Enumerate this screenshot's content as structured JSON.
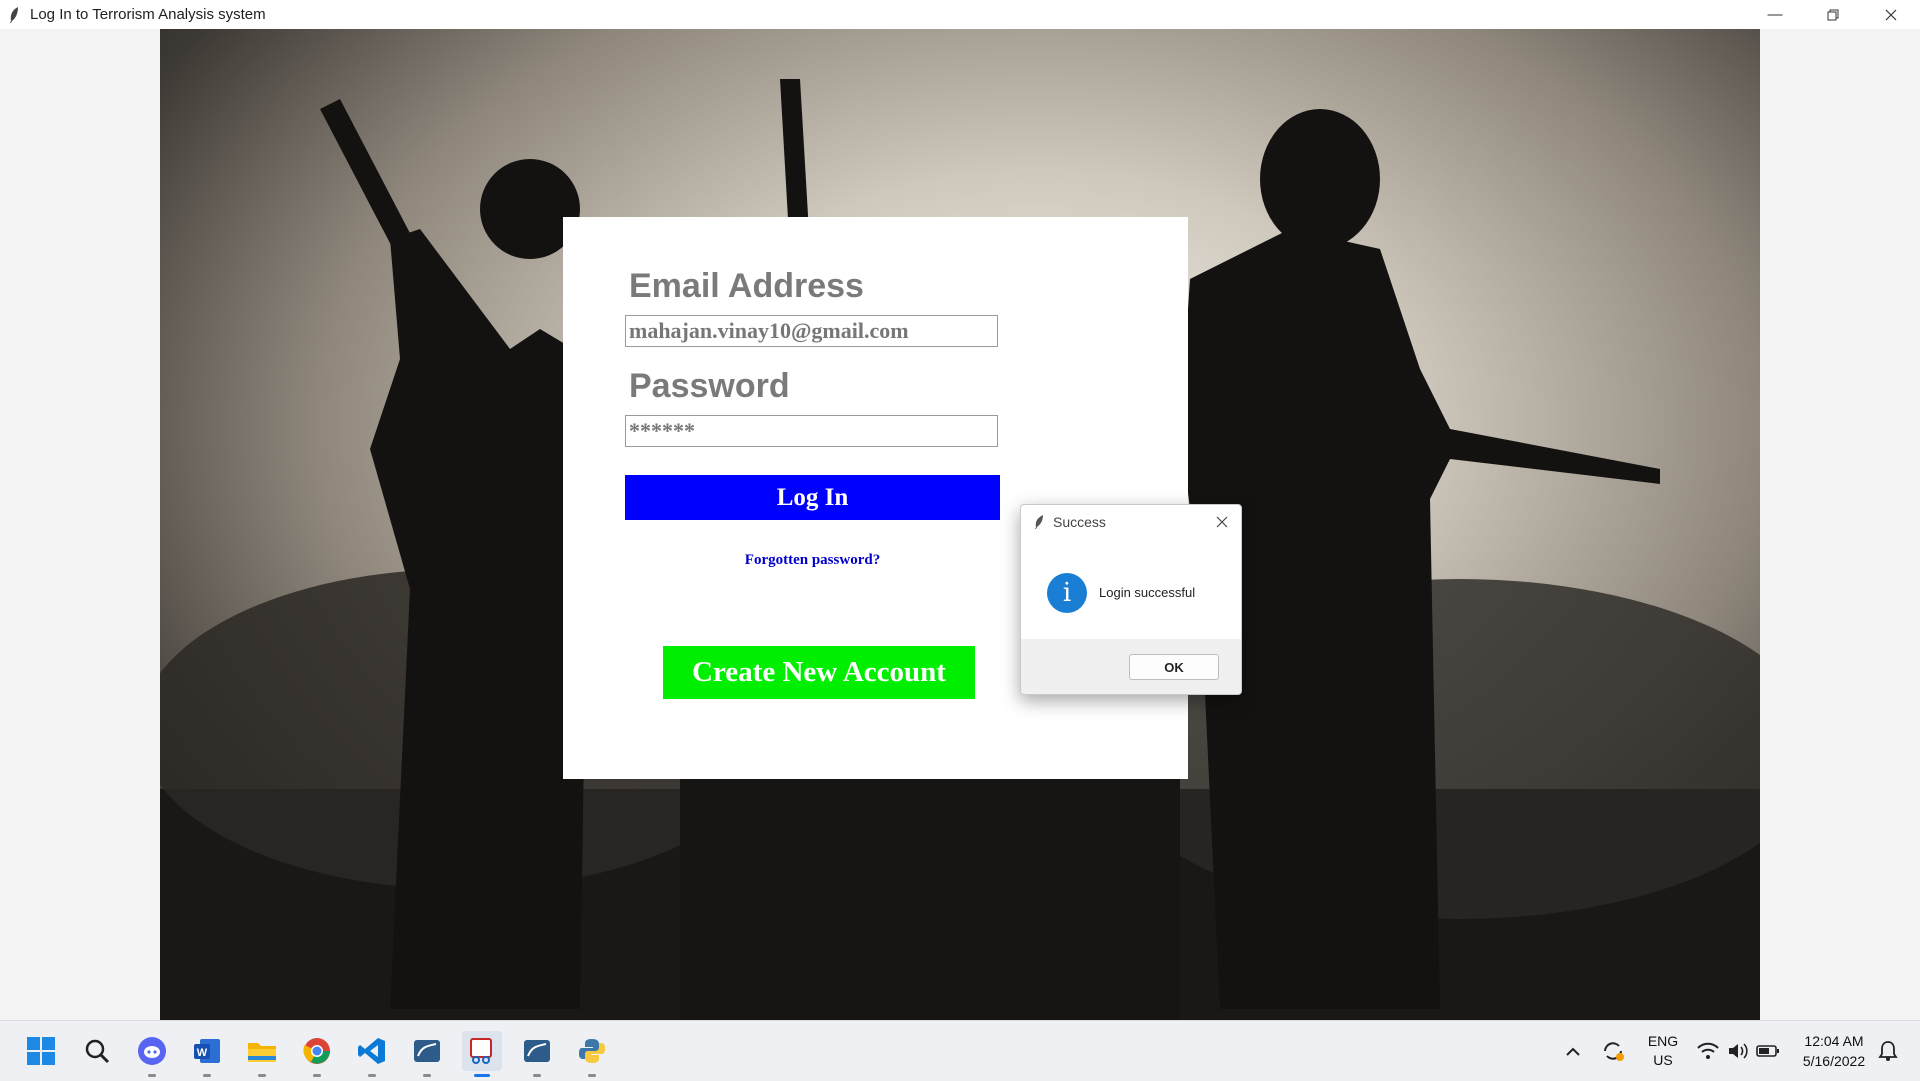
{
  "window": {
    "title": "Log In to Terrorism Analysis system"
  },
  "login": {
    "email_label": "Email Address",
    "email_value": "mahajan.vinay10@gmail.com",
    "password_label": "Password",
    "password_value": "******",
    "login_button": "Log In",
    "forgot_link": "Forgotten password?",
    "create_button": "Create New Account"
  },
  "dialog": {
    "title": "Success",
    "message": "Login successful",
    "ok_button": "OK",
    "icon": "info-icon"
  },
  "taskbar": {
    "apps": [
      "start-icon",
      "search-icon",
      "discord-icon",
      "word-icon",
      "file-explorer-icon",
      "chrome-icon",
      "vscode-icon",
      "mysql-workbench-icon",
      "snipping-tool-icon",
      "mysql-workbench-icon",
      "python-icon"
    ],
    "language_line1": "ENG",
    "language_line2": "US",
    "time": "12:04 AM",
    "date": "5/16/2022"
  },
  "colors": {
    "login_button": "#0000ff",
    "create_button": "#00ee00",
    "label_gray": "#7a7a7a",
    "info_blue": "#1a7fd4"
  }
}
